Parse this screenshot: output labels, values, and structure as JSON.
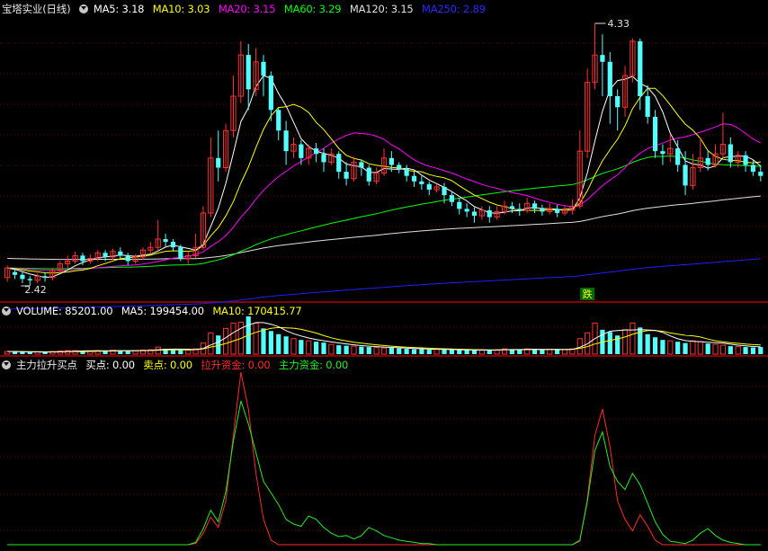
{
  "colors": {
    "up": "#ff3232",
    "down": "#54ffff",
    "ma5": "#ffffff",
    "ma10": "#ffff00",
    "ma20": "#ff00ff",
    "ma60": "#00ff00",
    "ma120": "#e0e0e0",
    "ma250": "#1e1eff",
    "vma5": "#ffffff",
    "vma10": "#ffff00",
    "sell_line": "#ff2a2a",
    "fund_line": "#22ee22",
    "grid": "#7a0000",
    "border": "#b00000"
  },
  "price_panel": {
    "stock_name": "宝塔实业",
    "period": "(日线)",
    "ma5": "MA5: 3.18",
    "ma10": "MA10: 3.03",
    "ma20": "MA20: 3.15",
    "ma60": "MA60: 3.29",
    "ma120": "MA120: 3.15",
    "ma250": "MA250: 2.89",
    "high_label": "4.33",
    "low_label": "2.42",
    "signal_text": "跌"
  },
  "volume_panel": {
    "volume": "VOLUME: 85201.00",
    "ma5": "MA5: 199454.00",
    "ma10": "MA10: 170415.77"
  },
  "indicator_panel": {
    "title": "主力拉升买点",
    "buy": "买点: 0.00",
    "sell": "卖点: 0.00",
    "lift_fund": "拉升资金: 0.00",
    "main_fund": "主力资金: 0.00"
  },
  "chart_data": [
    {
      "type": "candlestick",
      "title": "宝塔实业 (日线)",
      "high": 4.33,
      "low": 2.42,
      "ma_latest": {
        "MA5": 3.18,
        "MA10": 3.03,
        "MA20": 3.15,
        "MA60": 3.29,
        "MA120": 3.15,
        "MA250": 2.89
      },
      "candles": [
        [
          2.48,
          2.55,
          2.45,
          2.57
        ],
        [
          2.52,
          2.5,
          2.47,
          2.55
        ],
        [
          2.5,
          2.47,
          2.44,
          2.52
        ],
        [
          2.47,
          2.46,
          2.42,
          2.49
        ],
        [
          2.46,
          2.49,
          2.44,
          2.51
        ],
        [
          2.49,
          2.48,
          2.45,
          2.52
        ],
        [
          2.48,
          2.53,
          2.46,
          2.55
        ],
        [
          2.53,
          2.58,
          2.51,
          2.6
        ],
        [
          2.58,
          2.6,
          2.55,
          2.64
        ],
        [
          2.6,
          2.64,
          2.58,
          2.67
        ],
        [
          2.64,
          2.6,
          2.57,
          2.66
        ],
        [
          2.6,
          2.62,
          2.58,
          2.65
        ],
        [
          2.62,
          2.66,
          2.6,
          2.68
        ],
        [
          2.66,
          2.63,
          2.6,
          2.68
        ],
        [
          2.63,
          2.67,
          2.61,
          2.69
        ],
        [
          2.67,
          2.64,
          2.62,
          2.7
        ],
        [
          2.64,
          2.6,
          2.57,
          2.66
        ],
        [
          2.6,
          2.63,
          2.58,
          2.65
        ],
        [
          2.63,
          2.68,
          2.61,
          2.7
        ],
        [
          2.68,
          2.7,
          2.65,
          2.74
        ],
        [
          2.7,
          2.76,
          2.68,
          2.9
        ],
        [
          2.76,
          2.74,
          2.7,
          2.8
        ],
        [
          2.74,
          2.7,
          2.67,
          2.76
        ],
        [
          2.7,
          2.62,
          2.6,
          2.72
        ],
        [
          2.62,
          2.64,
          2.58,
          2.67
        ],
        [
          2.64,
          2.7,
          2.62,
          2.8
        ],
        [
          2.7,
          2.95,
          2.68,
          3.0
        ],
        [
          2.95,
          3.35,
          2.92,
          3.5
        ],
        [
          3.35,
          3.28,
          3.18,
          3.55
        ],
        [
          3.28,
          3.55,
          3.25,
          3.6
        ],
        [
          3.55,
          3.8,
          3.5,
          3.95
        ],
        [
          3.8,
          4.1,
          3.75,
          4.2
        ],
        [
          4.1,
          3.85,
          3.7,
          4.18
        ],
        [
          3.85,
          4.05,
          3.8,
          4.15
        ],
        [
          4.05,
          3.95,
          3.8,
          4.1
        ],
        [
          3.95,
          3.7,
          3.62,
          3.98
        ],
        [
          3.7,
          3.55,
          3.48,
          3.72
        ],
        [
          3.55,
          3.4,
          3.3,
          3.62
        ],
        [
          3.4,
          3.45,
          3.35,
          3.5
        ],
        [
          3.45,
          3.35,
          3.3,
          3.48
        ],
        [
          3.35,
          3.42,
          3.3,
          3.45
        ],
        [
          3.42,
          3.38,
          3.32,
          3.46
        ],
        [
          3.38,
          3.32,
          3.25,
          3.42
        ],
        [
          3.32,
          3.38,
          3.3,
          3.42
        ],
        [
          3.38,
          3.25,
          3.2,
          3.4
        ],
        [
          3.25,
          3.2,
          3.15,
          3.32
        ],
        [
          3.2,
          3.32,
          3.18,
          3.36
        ],
        [
          3.32,
          3.28,
          3.22,
          3.34
        ],
        [
          3.28,
          3.18,
          3.15,
          3.3
        ],
        [
          3.18,
          3.24,
          3.16,
          3.28
        ],
        [
          3.24,
          3.35,
          3.22,
          3.42
        ],
        [
          3.35,
          3.3,
          3.25,
          3.4
        ],
        [
          3.3,
          3.27,
          3.24,
          3.32
        ],
        [
          3.27,
          3.22,
          3.18,
          3.3
        ],
        [
          3.22,
          3.18,
          3.14,
          3.25
        ],
        [
          3.18,
          3.16,
          3.12,
          3.22
        ],
        [
          3.16,
          3.12,
          3.08,
          3.18
        ],
        [
          3.12,
          3.14,
          3.1,
          3.16
        ],
        [
          3.14,
          3.08,
          3.02,
          3.17
        ],
        [
          3.08,
          3.03,
          3.0,
          3.1
        ],
        [
          3.03,
          2.98,
          2.94,
          3.06
        ],
        [
          2.98,
          2.96,
          2.92,
          3.02
        ],
        [
          2.96,
          2.93,
          2.88,
          2.99
        ],
        [
          2.93,
          2.97,
          2.9,
          3.0
        ],
        [
          2.97,
          2.92,
          2.88,
          3.0
        ],
        [
          2.92,
          2.96,
          2.9,
          3.0
        ],
        [
          2.96,
          3.0,
          2.94,
          3.04
        ],
        [
          3.0,
          2.98,
          2.95,
          3.03
        ],
        [
          2.98,
          2.97,
          2.93,
          3.02
        ],
        [
          2.97,
          3.02,
          2.95,
          3.06
        ],
        [
          3.02,
          2.98,
          2.95,
          3.04
        ],
        [
          2.98,
          2.96,
          2.93,
          3.01
        ],
        [
          2.96,
          2.98,
          2.94,
          3.02
        ],
        [
          2.98,
          2.95,
          2.92,
          3.01
        ],
        [
          2.95,
          2.97,
          2.93,
          3.0
        ],
        [
          2.97,
          3.0,
          2.94,
          3.05
        ],
        [
          3.0,
          3.4,
          2.98,
          3.55
        ],
        [
          3.4,
          3.9,
          3.35,
          4.0
        ],
        [
          3.9,
          4.1,
          3.85,
          4.33
        ],
        [
          4.1,
          4.05,
          3.8,
          4.25
        ],
        [
          4.05,
          3.8,
          3.6,
          4.12
        ],
        [
          3.8,
          3.72,
          3.55,
          3.85
        ],
        [
          3.72,
          3.95,
          3.65,
          4.02
        ],
        [
          3.95,
          4.2,
          3.9,
          4.22
        ],
        [
          4.2,
          3.8,
          3.7,
          4.22
        ],
        [
          3.8,
          3.65,
          3.6,
          3.88
        ],
        [
          3.65,
          3.4,
          3.35,
          3.7
        ],
        [
          3.4,
          3.38,
          3.3,
          3.45
        ],
        [
          3.38,
          3.42,
          3.32,
          3.52
        ],
        [
          3.42,
          3.3,
          3.25,
          3.48
        ],
        [
          3.3,
          3.15,
          3.08,
          3.4
        ],
        [
          3.15,
          3.28,
          3.12,
          3.38
        ],
        [
          3.28,
          3.35,
          3.25,
          3.5
        ],
        [
          3.35,
          3.3,
          3.26,
          3.4
        ],
        [
          3.3,
          3.38,
          3.28,
          3.45
        ],
        [
          3.38,
          3.45,
          3.35,
          3.68
        ],
        [
          3.45,
          3.32,
          3.28,
          3.5
        ],
        [
          3.32,
          3.37,
          3.28,
          3.4
        ],
        [
          3.37,
          3.3,
          3.25,
          3.4
        ],
        [
          3.3,
          3.25,
          3.22,
          3.34
        ],
        [
          3.25,
          3.22,
          3.18,
          3.3
        ]
      ]
    },
    {
      "type": "bar",
      "title": "VOLUME",
      "values": [
        6,
        5,
        5,
        4,
        5,
        4,
        6,
        7,
        8,
        8,
        7,
        7,
        8,
        7,
        9,
        8,
        7,
        8,
        9,
        10,
        16,
        12,
        10,
        9,
        9,
        12,
        25,
        48,
        42,
        58,
        70,
        72,
        85,
        70,
        58,
        52,
        45,
        40,
        35,
        32,
        30,
        28,
        26,
        22,
        20,
        19,
        18,
        17,
        16,
        15,
        14,
        14,
        13,
        12,
        11,
        11,
        10,
        11,
        10,
        10,
        9,
        9,
        9,
        10,
        9,
        10,
        12,
        11,
        10,
        12,
        11,
        10,
        11,
        10,
        10,
        12,
        35,
        48,
        70,
        55,
        50,
        42,
        55,
        70,
        60,
        45,
        38,
        32,
        30,
        28,
        25,
        30,
        28,
        24,
        22,
        20,
        18,
        17,
        16,
        15,
        16
      ],
      "latest": 85201.0,
      "ma5_latest": 199454.0,
      "ma10_latest": 170415.77
    },
    {
      "type": "line",
      "title": "主力拉升买点",
      "series": [
        {
          "name": "拉升资金",
          "values": [
            0,
            0,
            0,
            0,
            0,
            0,
            0,
            0,
            0,
            0,
            0,
            0,
            0,
            0,
            0,
            0,
            0,
            0,
            0,
            0,
            0,
            0,
            0,
            0,
            0,
            1,
            10,
            24,
            15,
            38,
            95,
            150,
            118,
            62,
            22,
            4,
            0,
            0,
            0,
            0,
            0,
            0,
            0,
            0,
            0,
            0,
            0,
            0,
            0,
            0,
            0,
            0,
            0,
            0,
            0,
            0,
            0,
            0,
            0,
            0,
            0,
            0,
            0,
            0,
            0,
            0,
            0,
            0,
            0,
            0,
            0,
            0,
            0,
            0,
            0,
            0,
            3,
            40,
            95,
            118,
            85,
            38,
            22,
            12,
            26,
            16,
            4,
            0,
            0,
            0,
            0,
            0,
            0,
            0,
            0,
            0,
            0,
            0,
            0,
            0,
            0
          ]
        },
        {
          "name": "主力资金",
          "values": [
            0,
            0,
            0,
            0,
            0,
            0,
            0,
            0,
            0,
            0,
            0,
            0,
            0,
            0,
            0,
            0,
            0,
            0,
            0,
            0,
            0,
            0,
            0,
            0,
            0,
            2,
            14,
            30,
            20,
            46,
            90,
            125,
            105,
            80,
            55,
            45,
            35,
            22,
            18,
            16,
            25,
            22,
            15,
            10,
            7,
            8,
            5,
            8,
            15,
            12,
            8,
            6,
            4,
            3,
            2,
            1,
            1,
            0,
            0,
            0,
            0,
            0,
            0,
            0,
            0,
            0,
            0,
            0,
            0,
            0,
            0,
            0,
            0,
            0,
            0,
            0,
            4,
            38,
            82,
            98,
            68,
            55,
            48,
            62,
            52,
            36,
            20,
            9,
            3,
            2,
            1,
            4,
            10,
            14,
            8,
            4,
            2,
            1,
            0,
            0,
            0
          ]
        }
      ],
      "buy": 0.0,
      "sell": 0.0,
      "lift_fund": 0.0,
      "main_fund": 0.0
    }
  ]
}
